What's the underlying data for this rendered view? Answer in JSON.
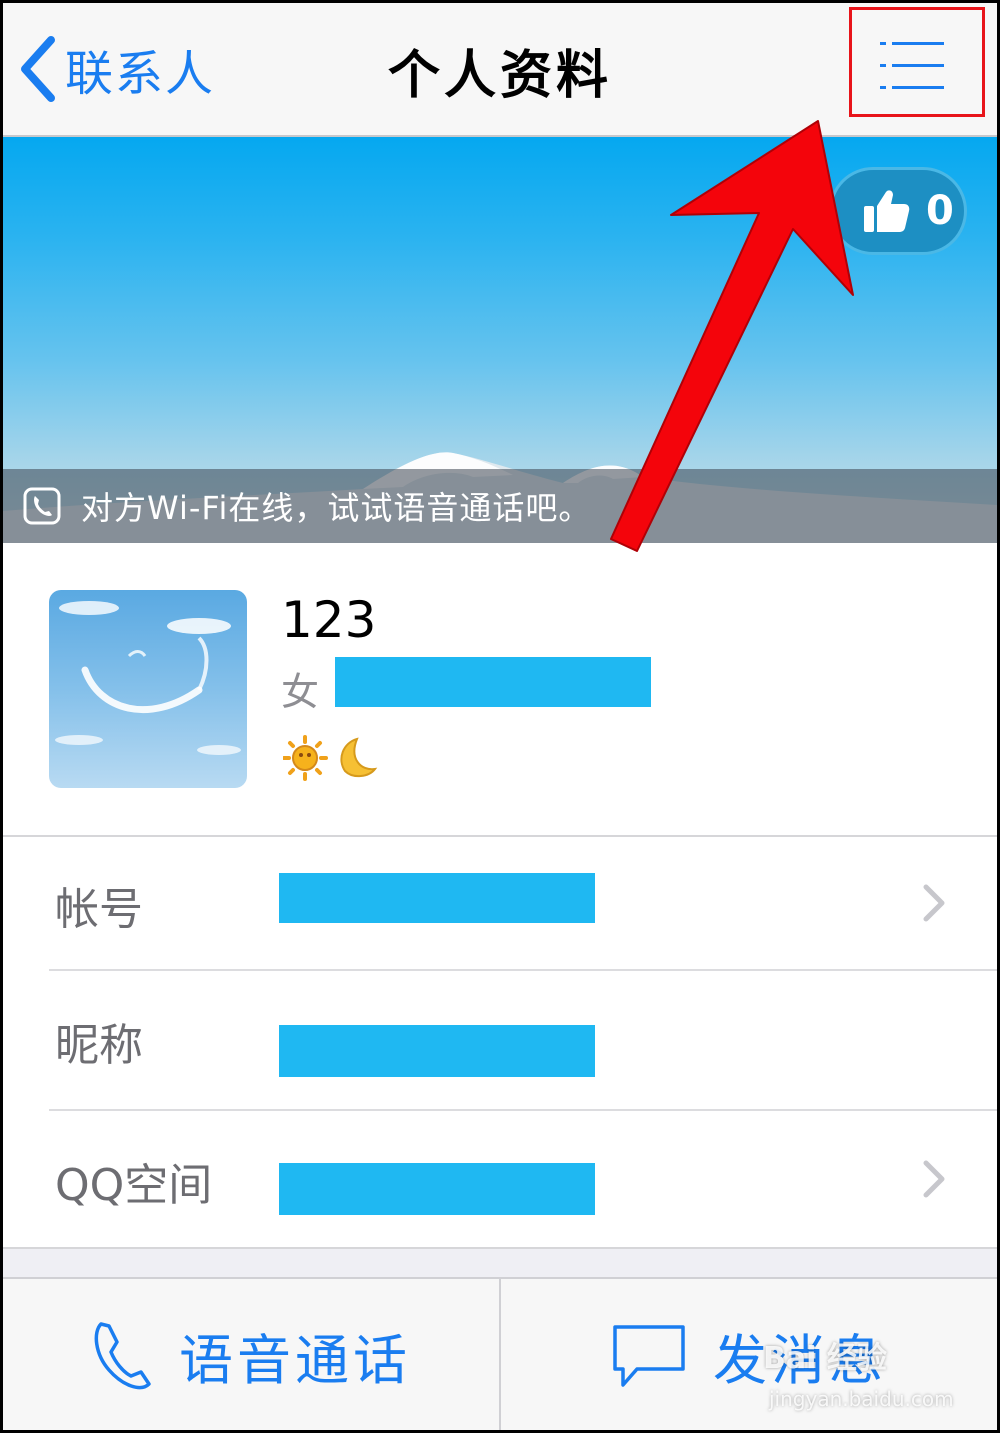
{
  "nav": {
    "back_label": "联系人",
    "title": "个人资料"
  },
  "banner": {
    "like_count": "0",
    "voice_hint": "对方Wi-Fi在线，试试语音通话吧。"
  },
  "profile": {
    "name": "123",
    "gender": "女"
  },
  "rows": [
    {
      "label": "帐号",
      "value": "",
      "has_chevron": true
    },
    {
      "label": "昵称",
      "value": "",
      "has_chevron": false
    },
    {
      "label": "QQ空间",
      "value": "",
      "has_chevron": true
    }
  ],
  "bottom": {
    "call_label": "语音通话",
    "message_label": "发消息"
  },
  "watermark": {
    "text": "Bai 经验",
    "sub": "jingyan.baidu.com"
  },
  "colors": {
    "accent": "#1a7df0",
    "highlight_box": "#e8141a",
    "redaction": "#1fb8f2"
  }
}
